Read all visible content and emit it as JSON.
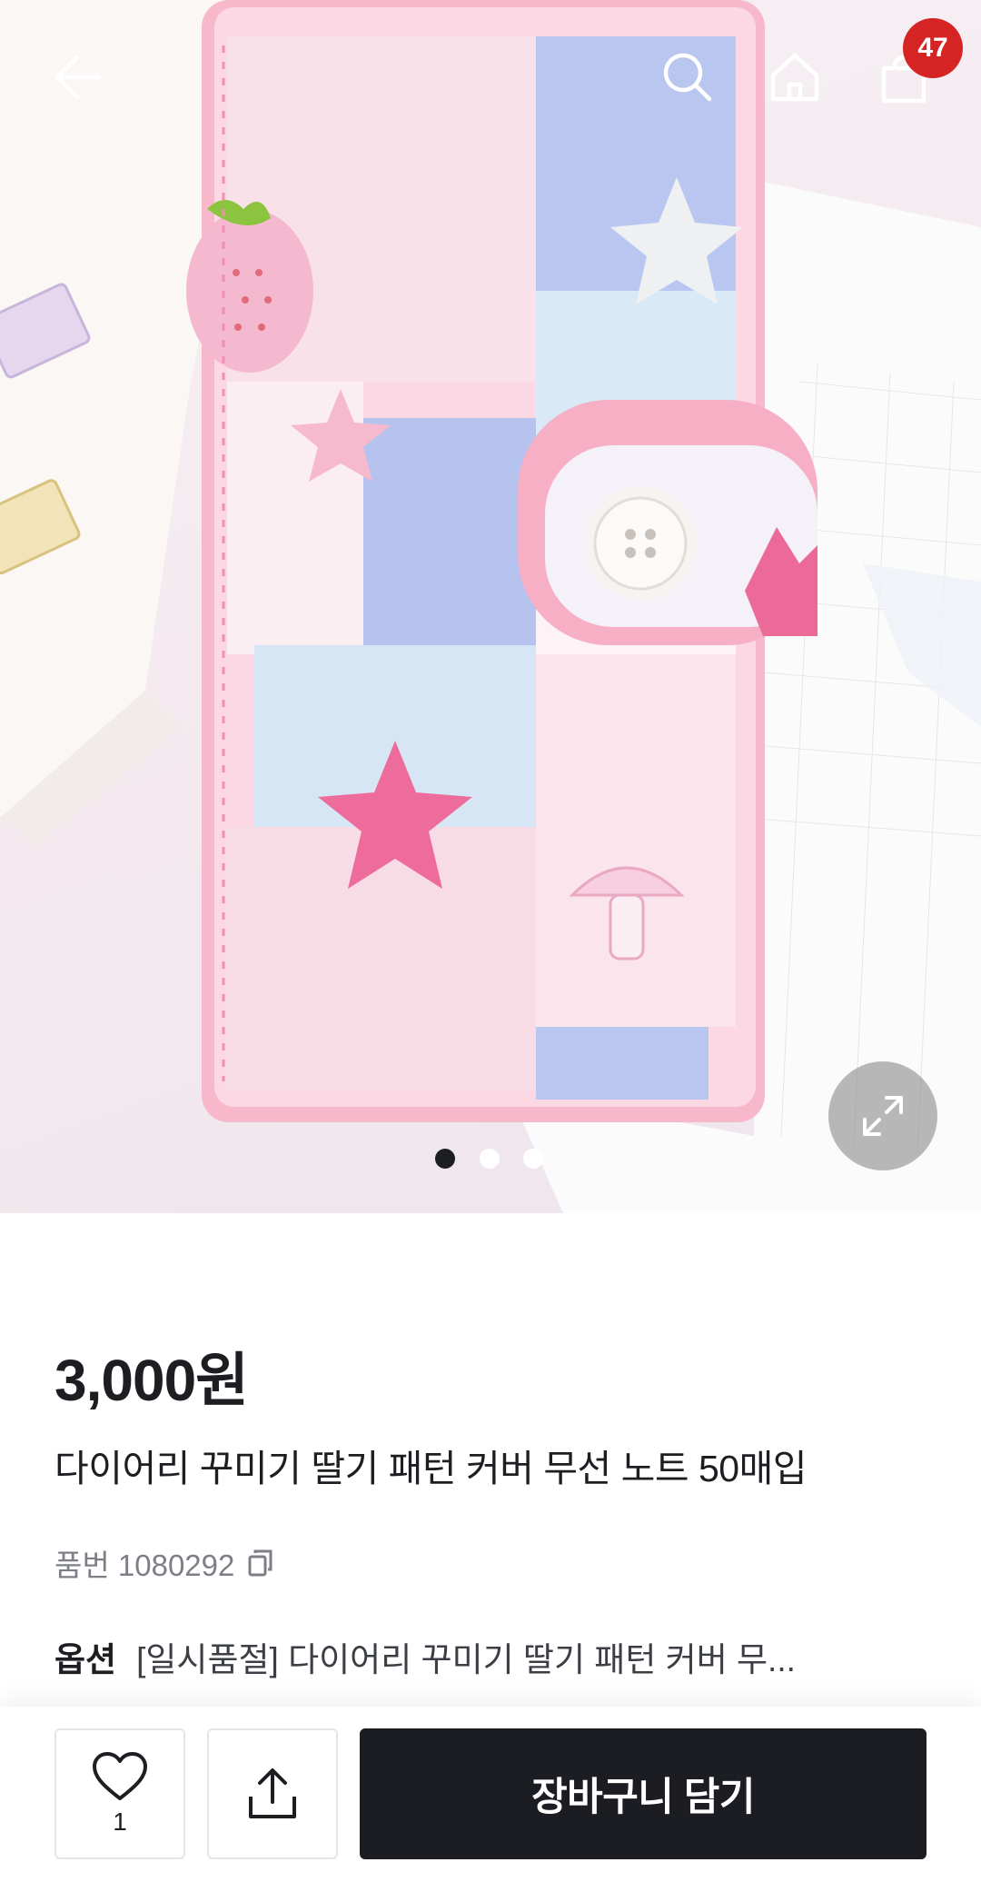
{
  "header": {
    "cart_count": "47",
    "icons": [
      "back-arrow-icon",
      "search-icon",
      "home-icon",
      "shopping-bag-icon"
    ]
  },
  "gallery": {
    "page_count": 3,
    "active_index": 0,
    "expand_icon": "expand-arrows-icon"
  },
  "product": {
    "price": "3,000원",
    "title": "다이어리 꾸미기 딸기 패턴 커버 무선 노트 50매입",
    "code_label": "품번 1080292",
    "option_label": "옵션",
    "option_value": "[일시품절] 다이어리 꾸미기 딸기 패턴 커버 무..."
  },
  "bottom_bar": {
    "like_count": "1",
    "add_to_cart_label": "장바구니 담기"
  },
  "colors": {
    "dark": "#1b1d22",
    "badge": "#d62424",
    "muted_text": "#7c7f86"
  }
}
